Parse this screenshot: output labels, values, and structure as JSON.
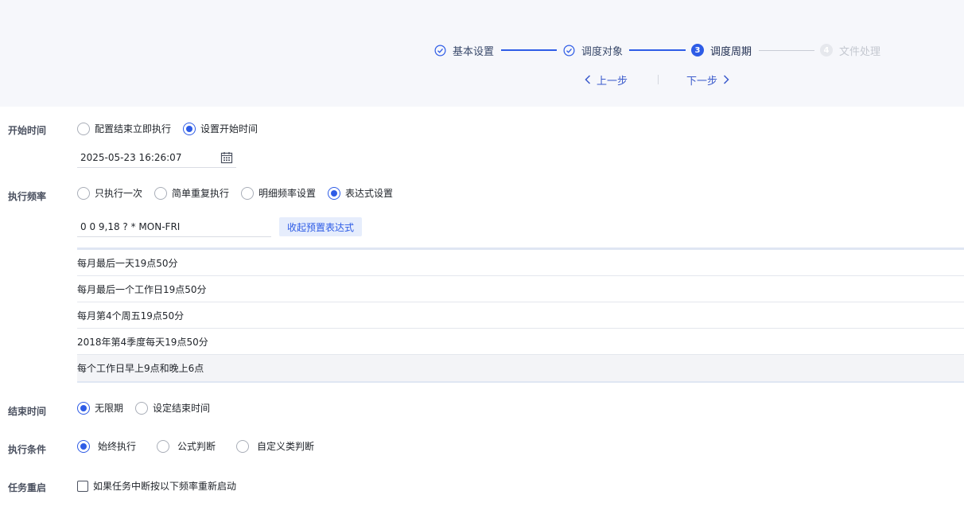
{
  "steps": [
    {
      "label": "基本设置",
      "state": "done",
      "icon": "check-circle-icon"
    },
    {
      "label": "调度对象",
      "state": "done",
      "icon": "check-circle-icon"
    },
    {
      "label": "调度周期",
      "state": "active",
      "number": "3"
    },
    {
      "label": "文件处理",
      "state": "pending",
      "number": "4"
    }
  ],
  "nav": {
    "prev_label": "上一步",
    "next_label": "下一步"
  },
  "start_time": {
    "label": "开始时间",
    "options": [
      "配置结束立即执行",
      "设置开始时间"
    ],
    "selected": 1,
    "value": "2025-05-23 16:26:07"
  },
  "frequency": {
    "label": "执行频率",
    "options": [
      "只执行一次",
      "简单重复执行",
      "明细频率设置",
      "表达式设置"
    ],
    "selected": 3,
    "expression": "0 0 9,18 ? * MON-FRI",
    "preset_toggle_label": "收起预置表达式",
    "presets": [
      "每月最后一天19点50分",
      "每月最后一个工作日19点50分",
      "每月第4个周五19点50分",
      "2018年第4季度每天19点50分",
      "每个工作日早上9点和晚上6点"
    ]
  },
  "end_time": {
    "label": "结束时间",
    "options": [
      "无限期",
      "设定结束时间"
    ],
    "selected": 0
  },
  "condition": {
    "label": "执行条件",
    "options": [
      "始终执行",
      "公式判断",
      "自定义类判断"
    ],
    "selected": 0
  },
  "restart": {
    "label": "任务重启",
    "checkbox_label": "如果任务中断按以下频率重新启动",
    "checked": false
  },
  "colors": {
    "accent": "#2e5ce6",
    "header_bg": "#f6f7fb",
    "pending": "#c4c8d0"
  }
}
